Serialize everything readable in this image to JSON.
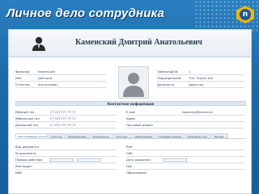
{
  "slide": {
    "title": "Личное дело сотрудника"
  },
  "logo": {
    "letter": "n",
    "caption": ""
  },
  "employee": {
    "full_name": "Каменский Дмитрий Анатольевич"
  },
  "personal": {
    "fields": [
      {
        "label": "Фамилия",
        "value": "Каменский"
      },
      {
        "label": "Имя",
        "value": "Дмитрий"
      },
      {
        "label": "Отчество",
        "value": "Анатольевич"
      }
    ]
  },
  "job": {
    "fields": [
      {
        "label": "Табельный №",
        "value": "1"
      },
      {
        "label": "Подразделение",
        "value": "ТОО \"Expert 8.6\""
      },
      {
        "label": "Должность",
        "value": "Директор"
      }
    ]
  },
  "contacts": {
    "section_title": "Контактная информация",
    "left": [
      {
        "label": "Рабочий тел.",
        "value": "+7 727 777 77 77"
      },
      {
        "label": "Мобильный тел.",
        "value": "+7 727 777 77 77"
      },
      {
        "label": "Домашний тел.",
        "value": "+7 727 777 77 77"
      }
    ],
    "right": [
      {
        "label": "E-mail",
        "value": "kapensky@ardoco.kz"
      },
      {
        "label": "Адрес",
        "value": ""
      },
      {
        "label": "Почтовый индекс",
        "value": ""
      }
    ]
  },
  "tabs": [
    "Удостоверение личности",
    "Статусы",
    "Командировки",
    "Больничные",
    "Отпуска",
    "Образование",
    "Трудовая книжка",
    "Кадровый учет",
    "Прочее"
  ],
  "document": {
    "left": [
      {
        "label": "Вид документа"
      },
      {
        "label": "№ документа"
      },
      {
        "label": "Период действия"
      },
      {
        "label": "Кем выдан"
      },
      {
        "label": "ИИН"
      }
    ],
    "right": [
      {
        "label": "РНН"
      },
      {
        "label": "СИК"
      },
      {
        "label": "Дата рождения"
      },
      {
        "label": "Пол"
      },
      {
        "label": "Образование"
      }
    ]
  }
}
